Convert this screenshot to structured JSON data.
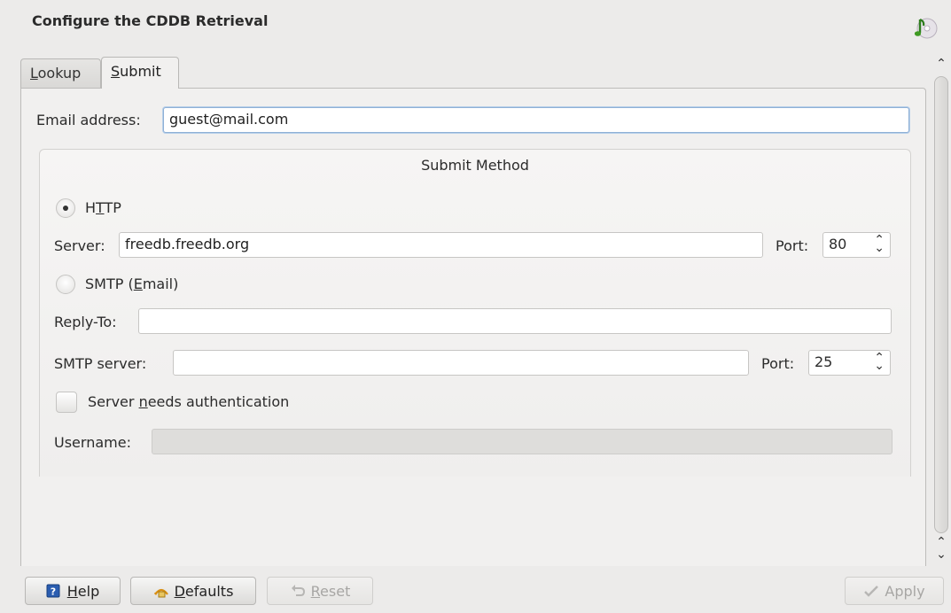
{
  "header": {
    "title": "Configure the CDDB Retrieval"
  },
  "tabs": {
    "lookup": {
      "label_first": "L",
      "label_rest": "ookup"
    },
    "submit": {
      "label_first": "S",
      "label_rest": "ubmit"
    }
  },
  "email": {
    "label": "Email address:",
    "value": "guest@mail.com"
  },
  "submit_method": {
    "title": "Submit Method",
    "http": {
      "label_pre": "H",
      "label_u": "T",
      "label_post": "TP",
      "selected": true
    },
    "http_server": {
      "label": "Server:",
      "value": "freedb.freedb.org",
      "port_label": "Port:",
      "port_value": "80"
    },
    "smtp": {
      "label_pre": "SMTP (",
      "label_u": "E",
      "label_post": "mail)",
      "selected": false
    },
    "reply_to": {
      "label": "Reply-To:",
      "value": ""
    },
    "smtp_server": {
      "label": "SMTP server:",
      "value": "",
      "port_label": "Port:",
      "port_value": "25"
    },
    "auth": {
      "label_pre": "Server ",
      "label_u": "n",
      "label_post": "eeds authentication",
      "checked": false
    },
    "username": {
      "label": "Username:",
      "value": ""
    }
  },
  "buttons": {
    "help": {
      "u": "H",
      "rest": "elp"
    },
    "defaults": {
      "u": "D",
      "rest": "efaults"
    },
    "reset": {
      "u": "R",
      "rest": "eset"
    },
    "apply": {
      "label": "Apply"
    }
  },
  "colors": {
    "window_bg": "#ecebea",
    "focus_border": "#8fb0d6",
    "help_icon": "#2a5db0"
  }
}
